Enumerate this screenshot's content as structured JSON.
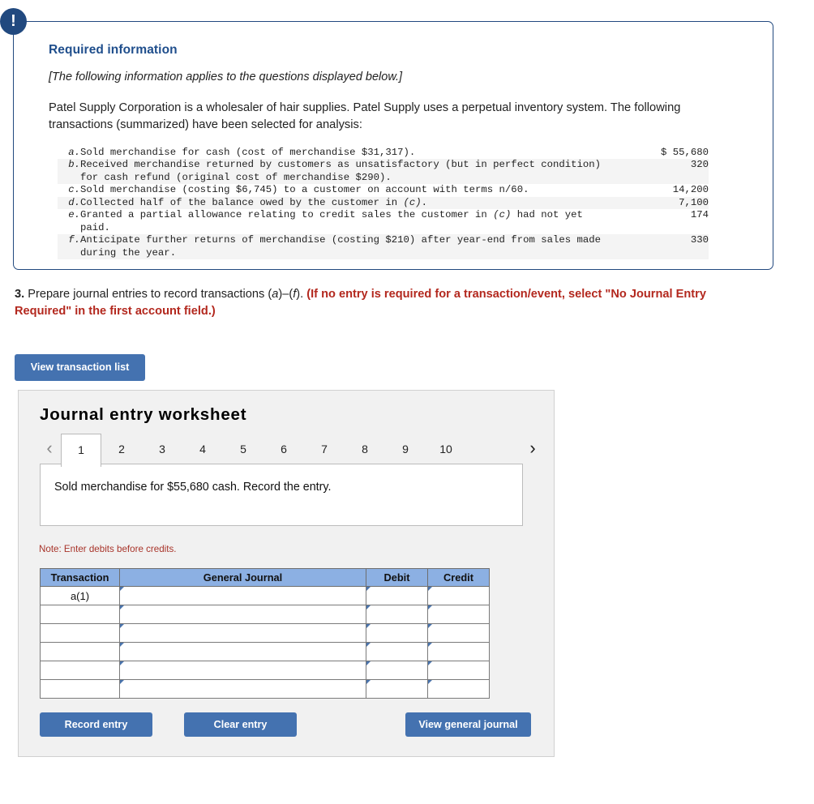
{
  "alert": {
    "icon": "exclamation-icon",
    "glyph": "!"
  },
  "info_panel": {
    "heading": "Required information",
    "applies_note": "[The following information applies to the questions displayed below.]",
    "intro": "Patel Supply Corporation is a wholesaler of hair supplies. Patel Supply uses a perpetual inventory system. The following transactions (summarized) have been selected for analysis:",
    "transactions": [
      {
        "letter": "a.",
        "desc": "Sold merchandise for cash (cost of merchandise $31,317).",
        "amount": "$ 55,680",
        "alt": false
      },
      {
        "letter": "b.",
        "desc": "Received merchandise returned by customers as unsatisfactory (but in perfect condition)\nfor cash refund (original cost of merchandise $290).",
        "amount": "320",
        "alt": true
      },
      {
        "letter": "c.",
        "desc": "Sold merchandise (costing $6,745) to a customer on account with terms n/60.",
        "amount": "14,200",
        "alt": false
      },
      {
        "letter": "d.",
        "desc": "Collected half of the balance owed by the customer in (c).",
        "amount": "7,100",
        "alt": true
      },
      {
        "letter": "e.",
        "desc": "Granted a partial allowance relating to credit sales the customer in (c) had not yet\npaid.",
        "amount": "174",
        "alt": false
      },
      {
        "letter": "f.",
        "desc": "Anticipate further returns of merchandise (costing $210) after year-end from sales made\nduring the year.",
        "amount": "330",
        "alt": true
      }
    ]
  },
  "question": {
    "number": "3.",
    "body": "Prepare journal entries to record transactions (a)–(f).",
    "highlight": "(If no entry is required for a transaction/event, select \"No Journal Entry Required\" in the first account field.)"
  },
  "view_transaction_list_label": "View transaction list",
  "worksheet": {
    "title": "Journal entry worksheet",
    "prev_icon": "chevron-left-icon",
    "next_icon": "chevron-right-icon",
    "prev_glyph": "‹",
    "next_glyph": "›",
    "tabs": [
      "1",
      "2",
      "3",
      "4",
      "5",
      "6",
      "7",
      "8",
      "9",
      "10"
    ],
    "active_tab": "1",
    "prompt": "Sold merchandise for $55,680 cash. Record the entry.",
    "note": "Note: Enter debits before credits.",
    "columns": [
      "Transaction",
      "General Journal",
      "Debit",
      "Credit"
    ],
    "rows": [
      {
        "transaction": "a(1)",
        "general_journal": "",
        "debit": "",
        "credit": ""
      },
      {
        "transaction": "",
        "general_journal": "",
        "debit": "",
        "credit": ""
      },
      {
        "transaction": "",
        "general_journal": "",
        "debit": "",
        "credit": ""
      },
      {
        "transaction": "",
        "general_journal": "",
        "debit": "",
        "credit": ""
      },
      {
        "transaction": "",
        "general_journal": "",
        "debit": "",
        "credit": ""
      },
      {
        "transaction": "",
        "general_journal": "",
        "debit": "",
        "credit": ""
      }
    ],
    "record_entry_label": "Record entry",
    "clear_entry_label": "Clear entry",
    "view_general_journal_label": "View general journal"
  },
  "colors": {
    "panel_border": "#22497f",
    "heading_blue": "#1f4e8c",
    "button_blue": "#4472b0",
    "table_header_blue": "#8cb0e3",
    "note_red": "#a8342a",
    "highlight_red": "#b3281e",
    "input_border_blue": "#6f9bd3"
  }
}
